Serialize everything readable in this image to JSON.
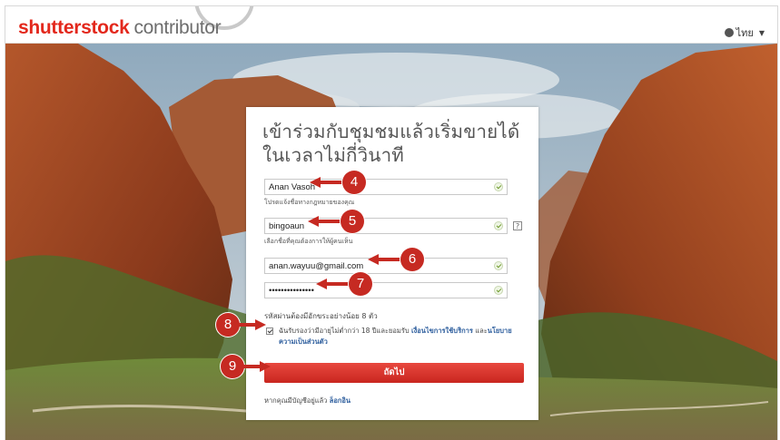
{
  "header": {
    "brand": "shutterst",
    "brand_o": "o",
    "brand_end": "ck",
    "product": "contributor",
    "language": "ไทย"
  },
  "form": {
    "title": "เข้าร่วมกับชุมชมแล้วเริ่มขายได้ในเวลาไม่กี่วินาที",
    "fields": [
      {
        "value": "Anan Vasoh",
        "hint": "โปรดแจ้งชื่อทางกฎหมายของคุณ"
      },
      {
        "value": "bingoaun",
        "hint": "เลือกชื่อที่คุณต้องการให้ผู้คนเห็น",
        "help": "?"
      },
      {
        "value": "anan.wayuu@gmail.com"
      },
      {
        "value": "•••••••••••••••"
      }
    ],
    "password_rule": "รหัสผ่านต้องมีอักขระอย่างน้อย 8 ตัว",
    "terms": {
      "prefix": "ฉันรับรองว่ามีอายุไม่ต่ำกว่า 18 ปีและยอมรับ ",
      "link_terms": "เงื่อนไขการใช้บริการ",
      "mid": " และ",
      "link_privacy": "นโยบายความเป็นส่วนตัว"
    },
    "submit_label": "ถัดไป",
    "login_prefix": "หากคุณมีบัญชีอยู่แล้ว ",
    "login_link": "ล็อกอิน"
  },
  "markers": [
    "4",
    "5",
    "6",
    "7",
    "8",
    "9"
  ],
  "colors": {
    "brand_red": "#e3281c",
    "marker_red": "#c62a22",
    "link_blue": "#2f5f9e",
    "valid_green": "#6d9a2b"
  }
}
